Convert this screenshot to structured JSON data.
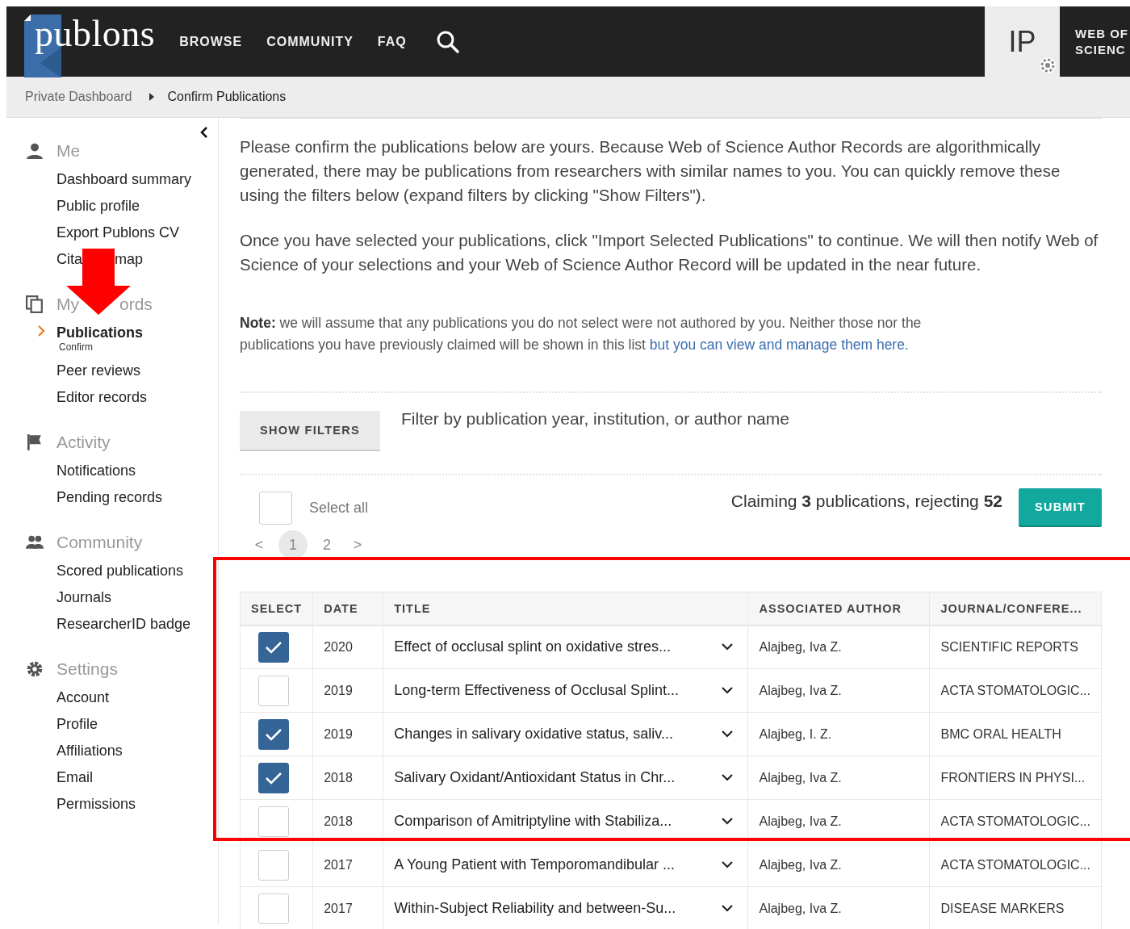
{
  "header": {
    "logo": "publons",
    "nav": [
      "BROWSE",
      "COMMUNITY",
      "FAQ"
    ],
    "avatar_initials": "IP",
    "wos_link": [
      "WEB OF",
      "SCIENC"
    ]
  },
  "breadcrumb": [
    "Private Dashboard",
    "Confirm Publications"
  ],
  "sidebar": {
    "sections": [
      {
        "title_parts": [
          "Me"
        ],
        "items": [
          {
            "label_parts": [
              "Dashboard summary"
            ],
            "selected": false
          },
          {
            "label_parts": [
              "Public profile"
            ],
            "selected": false
          },
          {
            "label_parts": [
              "Export Publons CV"
            ],
            "selected": false
          },
          {
            "label_parts": [
              "Cita",
              "map"
            ],
            "selected": false
          }
        ]
      },
      {
        "title_parts": [
          "My",
          "ords"
        ],
        "items": [
          {
            "label_parts": [
              "Publications"
            ],
            "selected": true,
            "sublabel": "Confirm"
          },
          {
            "label_parts": [
              "Peer reviews"
            ],
            "selected": false
          },
          {
            "label_parts": [
              "Editor records"
            ],
            "selected": false
          }
        ]
      },
      {
        "title_parts": [
          "Activity"
        ],
        "items": [
          {
            "label_parts": [
              "Notifications"
            ],
            "selected": false
          },
          {
            "label_parts": [
              "Pending records"
            ],
            "selected": false
          }
        ]
      },
      {
        "title_parts": [
          "Community"
        ],
        "items": [
          {
            "label_parts": [
              "Scored publications"
            ],
            "selected": false
          },
          {
            "label_parts": [
              "Journals"
            ],
            "selected": false
          },
          {
            "label_parts": [
              "ResearcherID badge"
            ],
            "selected": false
          }
        ]
      },
      {
        "title_parts": [
          "Settings"
        ],
        "items": [
          {
            "label_parts": [
              "Account"
            ],
            "selected": false
          },
          {
            "label_parts": [
              "Profile"
            ],
            "selected": false
          },
          {
            "label_parts": [
              "Affiliations"
            ],
            "selected": false
          },
          {
            "label_parts": [
              "Email"
            ],
            "selected": false
          },
          {
            "label_parts": [
              "Permissions"
            ],
            "selected": false
          }
        ]
      }
    ]
  },
  "intro": [
    "Please confirm the publications below are yours. Because Web of Science Author Records are algorithmically generated, there may be publications from researchers with similar names to you. You can quickly remove these using the filters below (expand filters by clicking \"Show Filters\").",
    "Once you have selected your publications, click \"Import Selected Publications\" to continue. We will then notify Web of Science of your selections and your Web of Science Author Record will be updated in the near future."
  ],
  "note": {
    "text": "**Note:** we will assume that any publications you do not select were not authored by you. Neither those nor the publications you have previously claimed will be shown in this list",
    "link": "but you can view and manage them here."
  },
  "filters": {
    "button": "SHOW FILTERS",
    "hint": "Filter by publication year, institution, or author name"
  },
  "select_all": {
    "label": "Select all",
    "checked": false
  },
  "claim_summary": "Claiming **3** publications, rejecting **52**",
  "submit": "SUBMIT",
  "pager": {
    "prev": "<",
    "pages": [
      {
        "label": "1",
        "selected": true
      },
      {
        "label": "2",
        "selected": false
      }
    ],
    "next": ">"
  },
  "table": {
    "columns": [
      "SELECT",
      "DATE",
      "TITLE",
      "ASSOCIATED AUTHOR",
      "JOURNAL/CONFERE..."
    ],
    "rows": [
      {
        "checked": true,
        "date": "2020",
        "title": "Effect of occlusal splint on oxidative stres...",
        "author": "Alajbeg, Iva Z.",
        "journal": "SCIENTIFIC REPORTS"
      },
      {
        "checked": false,
        "date": "2019",
        "title": "Long-term Effectiveness of Occlusal Splint...",
        "author": "Alajbeg, Iva Z.",
        "journal": "ACTA STOMATOLOGIC..."
      },
      {
        "checked": true,
        "date": "2019",
        "title": "Changes in salivary oxidative status, saliv...",
        "author": "Alajbeg, I. Z.",
        "journal": "BMC ORAL HEALTH"
      },
      {
        "checked": true,
        "date": "2018",
        "title": "Salivary Oxidant/Antioxidant Status in Chr...",
        "author": "Alajbeg, Iva Z.",
        "journal": "FRONTIERS IN PHYSI..."
      },
      {
        "checked": false,
        "date": "2018",
        "title": "Comparison of Amitriptyline with Stabiliza...",
        "author": "Alajbeg, Iva Z.",
        "journal": "ACTA STOMATOLOGIC..."
      },
      {
        "checked": false,
        "date": "2017",
        "title": "A Young Patient with Temporomandibular ...",
        "author": "Alajbeg, Iva Z.",
        "journal": "ACTA STOMATOLOGIC..."
      },
      {
        "checked": false,
        "date": "2017",
        "title": "Within-Subject Reliability and between-Su...",
        "author": "Alajbeg, Iva Z.",
        "journal": "DISEASE MARKERS"
      }
    ]
  }
}
